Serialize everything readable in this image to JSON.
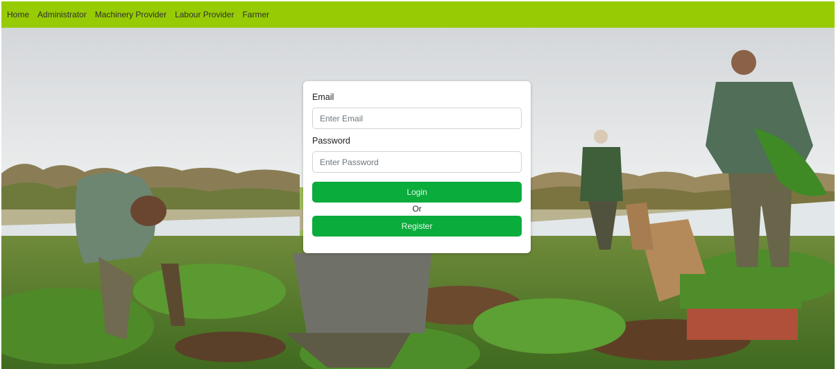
{
  "navbar": {
    "links": [
      "Home",
      "Administrator",
      "Machinery Provider",
      "Labour Provider",
      "Farmer"
    ],
    "background": "#97cc04"
  },
  "login_form": {
    "email_label": "Email",
    "email_placeholder": "Enter Email",
    "email_value": "",
    "password_label": "Password",
    "password_placeholder": "Enter Password",
    "password_value": "",
    "login_label": "Login",
    "or_text": "Or",
    "register_label": "Register",
    "button_color": "#0aac3c"
  },
  "hero": {
    "image": "farm-workers-harvesting-carrots-photo"
  }
}
